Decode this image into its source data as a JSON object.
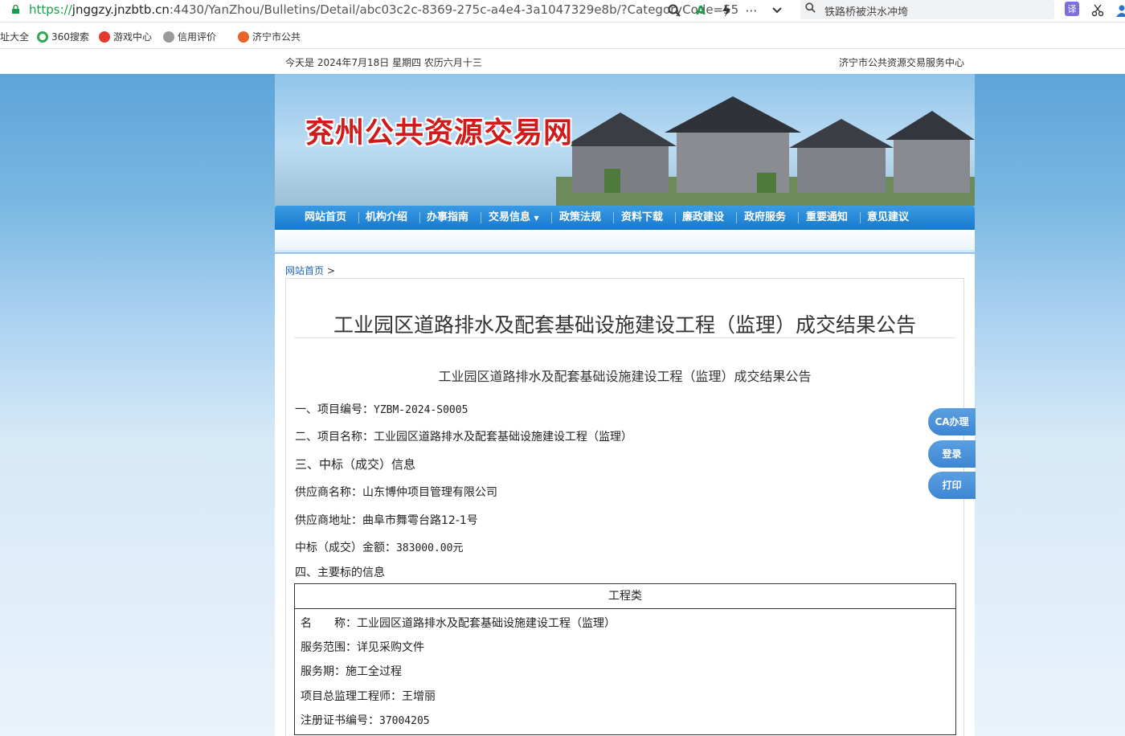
{
  "browser": {
    "url_scheme": "https://",
    "url_host": "jnggzy.jnzbtb.cn",
    "url_rest": ":4430/YanZhou/Bulletins/Detail/abc03c2c-8369-275c-a4e4-3a1047329e8b/?CategoryCode=55",
    "search_text": "铁路桥被洪水冲垮",
    "bookmarks": [
      {
        "label": "址大全",
        "icon_color": "#ffffff"
      },
      {
        "label": "360搜索",
        "icon_color": "#33a853"
      },
      {
        "label": "游戏中心",
        "icon_color": "#e23a2e"
      },
      {
        "label": "信用评价",
        "icon_color": "#9a9a9a"
      },
      {
        "label": "济宁市公共",
        "icon_color": "#e8652a"
      }
    ]
  },
  "topstrip": {
    "date": "今天是 2024年7月18日 星期四 农历六月十三",
    "org": "济宁市公共资源交易服务中心"
  },
  "banner": {
    "site_title": "兖州公共资源交易网"
  },
  "nav": {
    "items": [
      "网站首页",
      "机构介绍",
      "办事指南",
      "交易信息",
      "政策法规",
      "资料下载",
      "廉政建设",
      "政府服务",
      "重要通知",
      "意见建议"
    ]
  },
  "breadcrumb": {
    "home": "网站首页",
    "sep": ">"
  },
  "article": {
    "title": "工业园区道路排水及配套基础设施建设工程（监理）成交结果公告",
    "subtitle": "工业园区道路排水及配套基础设施建设工程（监理）成交结果公告",
    "l1_label": "一、项目编号：",
    "l1_value": "YZBM-2024-S0005",
    "l2": "二、项目名称：工业园区道路排水及配套基础设施建设工程（监理）",
    "l3": "三、中标（成交）信息",
    "l4": "供应商名称：山东博仲项目管理有限公司",
    "l5": "供应商地址：曲阜市舞雩台路12-1号",
    "l6_label": "中标（成交）金额：",
    "l6_value": "383000.00元",
    "l7": "四、主要标的信息"
  },
  "table": {
    "header": "工程类",
    "r1": "名　　称：工业园区道路排水及配套基础设施建设工程（监理）",
    "r2": "服务范围：详见采购文件",
    "r3": "服务期：施工全过程",
    "r4": "项目总监理工程师：王增丽",
    "r5_label": "注册证书编号：",
    "r5_value": "37004205"
  },
  "side": {
    "ca": "CA办理",
    "login": "登录",
    "print": "打印"
  }
}
